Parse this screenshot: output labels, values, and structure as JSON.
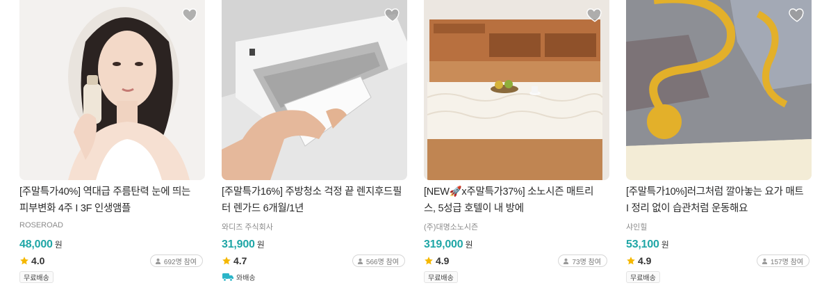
{
  "products": [
    {
      "title_line1": "[주말특가40%] 역대급 주름탄력 눈에 띄는",
      "title_line2": "피부변화 4주 I 3F 인생앰플",
      "brand": "ROSEROAD",
      "price": "48,000",
      "price_unit": "원",
      "rating": "4.0",
      "participants": "692명 참여",
      "shipping_badge": "무료배송",
      "image_icon": "skincare-model-image"
    },
    {
      "title_line1": "[주말특가16%] 주방청소 걱정 끝 렌지후드필",
      "title_line2": "터 렌가드 6개월/1년",
      "brand": "와디즈 주식회사",
      "price": "31,900",
      "price_unit": "원",
      "rating": "4.7",
      "participants": "566명 참여",
      "shipping_badge": "와배송",
      "shipping_icon": "truck-icon",
      "image_icon": "range-hood-filter-image"
    },
    {
      "title_line1": "[NEW🚀x주말특가37%] 소노시즌 매트리",
      "title_line2": "스, 5성급 호텔이 내 방에",
      "brand": "(주)대명소노시즌",
      "price": "319,000",
      "price_unit": "원",
      "rating": "4.9",
      "participants": "73명 참여",
      "shipping_badge": "무료배송",
      "image_icon": "bed-mattress-image"
    },
    {
      "title_line1": "[주말특가10%]러그처럼 깔아놓는 요가 매트",
      "title_line2": "I 정리 없이 습관처럼 운동해요",
      "brand": "샤인힐",
      "price": "53,100",
      "price_unit": "원",
      "rating": "4.9",
      "participants": "157명 참여",
      "shipping_badge": "무료배송",
      "image_icon": "yoga-mat-rug-image"
    }
  ],
  "colors": {
    "price": "#1fa6a6",
    "star": "#f5b800",
    "truck": "#2bb5c8"
  }
}
